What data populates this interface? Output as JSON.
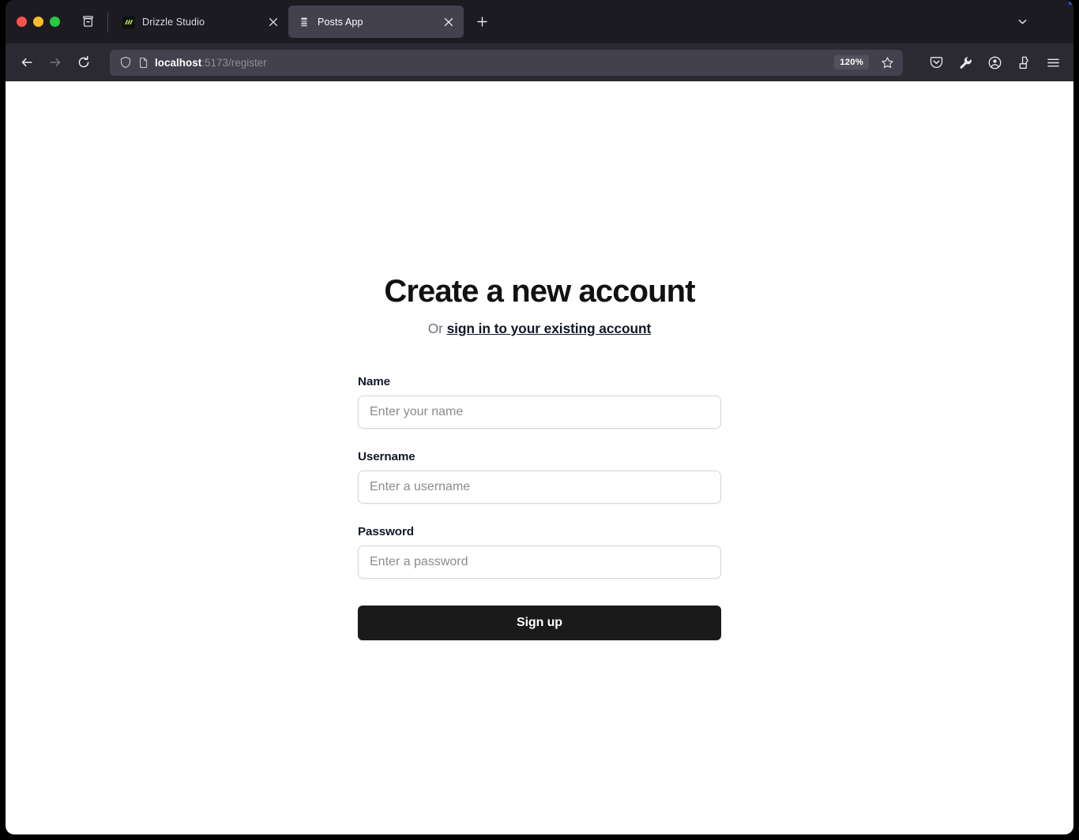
{
  "browser": {
    "window_controls": [
      {
        "name": "close",
        "color": "#f9544b"
      },
      {
        "name": "minimize",
        "color": "#fbbd2e"
      },
      {
        "name": "maximize",
        "color": "#28c940"
      }
    ],
    "sidebar_button_icon": "archive-icon",
    "tabs": [
      {
        "title": "Drizzle Studio",
        "favicon": "drizzle-squiggle-icon",
        "active": false,
        "close_label": "×"
      },
      {
        "title": "Posts App",
        "favicon": "posts-lines-icon",
        "active": true,
        "close_label": "×"
      }
    ],
    "new_tab_label": "+",
    "list_all_tabs_icon": "chevron-down-icon",
    "navigation": {
      "back_icon": "back-arrow-icon",
      "back_enabled": true,
      "forward_icon": "forward-arrow-icon",
      "forward_enabled": false,
      "reload_icon": "reload-icon"
    },
    "url_bar": {
      "shield_icon": "shield-icon",
      "page_icon": "page-document-icon",
      "host": "localhost",
      "path": ":5173/register",
      "full_url": "localhost:5173/register",
      "zoom_level": "120%",
      "bookmark_icon": "star-icon"
    },
    "toolbar_icons": [
      {
        "name": "pocket-icon",
        "label": "Save to Pocket"
      },
      {
        "name": "wrench-icon",
        "label": "Developer Tools"
      },
      {
        "name": "account-icon",
        "label": "Account"
      },
      {
        "name": "extensions-icon",
        "label": "Extensions"
      },
      {
        "name": "hamburger-menu-icon",
        "label": "Application Menu"
      }
    ]
  },
  "page": {
    "title": "Create a new account",
    "subtitle_prefix": "Or ",
    "subtitle_link": "sign in to your existing account",
    "form": {
      "fields": [
        {
          "label": "Name",
          "placeholder": "Enter your name",
          "value": "",
          "type": "text"
        },
        {
          "label": "Username",
          "placeholder": "Enter a username",
          "value": "",
          "type": "text"
        },
        {
          "label": "Password",
          "placeholder": "Enter a password",
          "value": "",
          "type": "password"
        }
      ],
      "submit_label": "Sign up"
    }
  },
  "colors": {
    "page_background": "#ffffff",
    "chrome_tabstrip": "#1c1b22",
    "chrome_toolbar": "#2b2a33",
    "urlbar_field": "#42414d",
    "active_tab": "#42414d",
    "text_primary": "#111827",
    "text_muted": "#6b7280",
    "placeholder": "#8b8b91",
    "input_border": "#d6d6db",
    "button_background": "#1a1a1a",
    "button_text": "#ffffff"
  }
}
